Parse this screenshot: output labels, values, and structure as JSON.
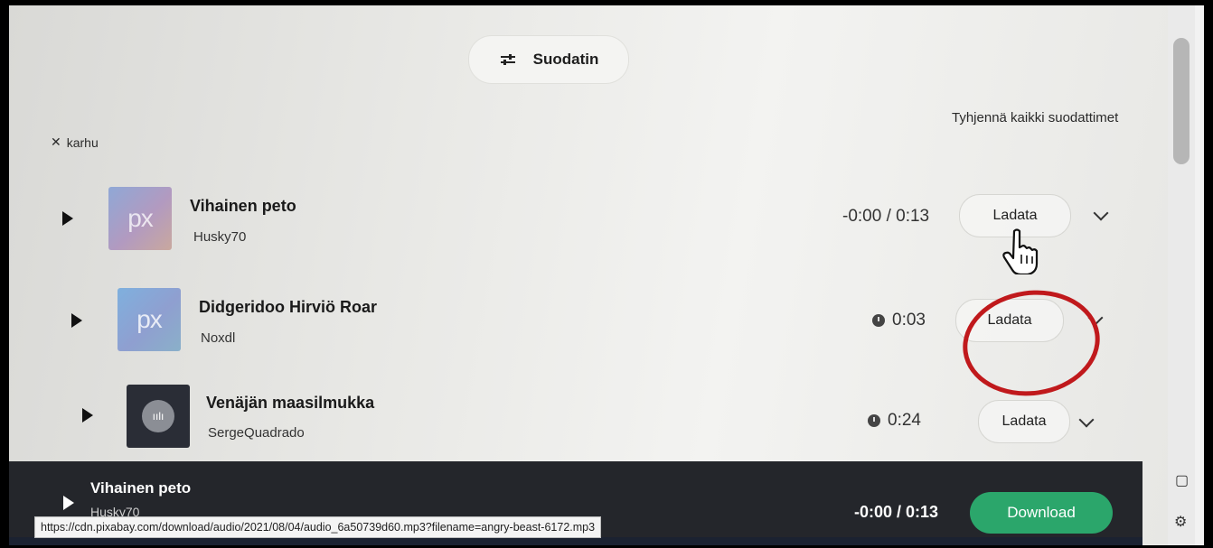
{
  "filter": {
    "label": "Suodatin",
    "icon": "sliders-icon"
  },
  "clear_all": "Tyhjennä kaikki suodattimet",
  "active_tag": {
    "close": "✕",
    "label": "karhu"
  },
  "tracks": [
    {
      "title": "Vihainen peto",
      "artist": "Husky70",
      "time": "-0:00 / 0:13",
      "download": "Ladata",
      "thumb": "px"
    },
    {
      "title": "Didgeridoo Hirviö Roar",
      "artist": "Noxdl",
      "time": "0:03",
      "download": "Ladata",
      "thumb": "px"
    },
    {
      "title": "Venäjän maasilmukka",
      "artist": "SergeQuadrado",
      "time": "0:24",
      "download": "Ladata",
      "thumb": "waveform"
    }
  ],
  "thumb_text": "px",
  "player": {
    "title": "Vihainen peto",
    "artist": "Husky70",
    "time": "-0:00 / 0:13",
    "download": "Download"
  },
  "status_url": "https://cdn.pixabay.com/download/audio/2021/08/04/audio_6a50739d60.mp3?filename=angry-beast-6172.mp3",
  "colors": {
    "accent_green": "#2ba66b",
    "annotation_red": "#c0191c",
    "player_bg": "#24262b"
  }
}
